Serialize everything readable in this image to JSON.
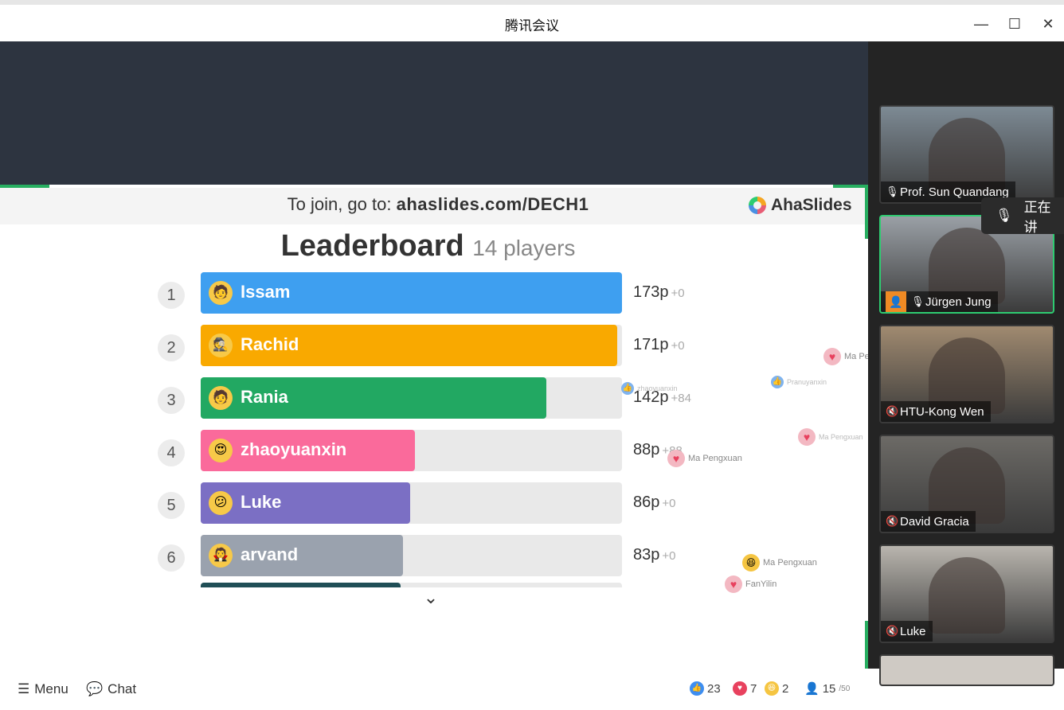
{
  "window": {
    "title": "腾讯会议",
    "minimize": "—",
    "maximize": "☐",
    "close": "✕"
  },
  "join_bar": {
    "prefix": "To join, go to:",
    "url": "ahaslides.com/DECH1",
    "brand": "AhaSlides"
  },
  "leaderboard": {
    "title": "Leaderboard",
    "players": "14 players",
    "max_points": 173,
    "rows": [
      {
        "rank": "1",
        "name": "Issam",
        "score": "173p",
        "delta": "+0",
        "points": 173,
        "color": "#3e9ff0",
        "avatar": "🧑"
      },
      {
        "rank": "2",
        "name": "Rachid",
        "score": "171p",
        "delta": "+0",
        "points": 171,
        "color": "#f9a900",
        "avatar": "🕵"
      },
      {
        "rank": "3",
        "name": "Rania",
        "score": "142p",
        "delta": "+84",
        "points": 142,
        "color": "#22a862",
        "avatar": "🧑"
      },
      {
        "rank": "4",
        "name": "zhaoyuanxin",
        "score": "88p",
        "delta": "+88",
        "points": 88,
        "color": "#fa6a9b",
        "avatar": "😍"
      },
      {
        "rank": "5",
        "name": "Luke",
        "score": "86p",
        "delta": "+0",
        "points": 86,
        "color": "#7b6fc4",
        "avatar": "😕"
      },
      {
        "rank": "6",
        "name": "arvand",
        "score": "83p",
        "delta": "+0",
        "points": 83,
        "color": "#9aa2ae",
        "avatar": "🧛"
      }
    ]
  },
  "reactions": [
    {
      "who": "Ma Pe",
      "kind": "heart"
    },
    {
      "who": "Pranuyanxin",
      "kind": "like"
    },
    {
      "who": "Ma Pengxuan",
      "kind": "heart"
    },
    {
      "who": "Ma Pengxuan",
      "kind": "heart"
    },
    {
      "who": "Ma Pengxuan",
      "kind": "laugh"
    },
    {
      "who": "FanYilin",
      "kind": "heart"
    },
    {
      "who": "zhaoyuanxin",
      "kind": "like"
    }
  ],
  "bottom": {
    "menu": "Menu",
    "chat": "Chat",
    "likes": "23",
    "hearts": "7",
    "laughs": "2",
    "audience": "15",
    "audience_max": "/50"
  },
  "participants": [
    {
      "name": "Prof. Sun Quandang",
      "muted": false,
      "active": false,
      "bg": "#7d8a94"
    },
    {
      "name": "Jürgen Jung",
      "muted": false,
      "active": true,
      "host": true,
      "bg": "#9aa0a6"
    },
    {
      "name": "HTU-Kong Wen",
      "muted": true,
      "active": false,
      "bg": "#a08a70"
    },
    {
      "name": "David Gracia",
      "muted": true,
      "active": false,
      "bg": "#6c6a66"
    },
    {
      "name": "Luke",
      "muted": true,
      "active": false,
      "bg": "#b9b5ae"
    }
  ],
  "speaking_popup": "正在讲"
}
